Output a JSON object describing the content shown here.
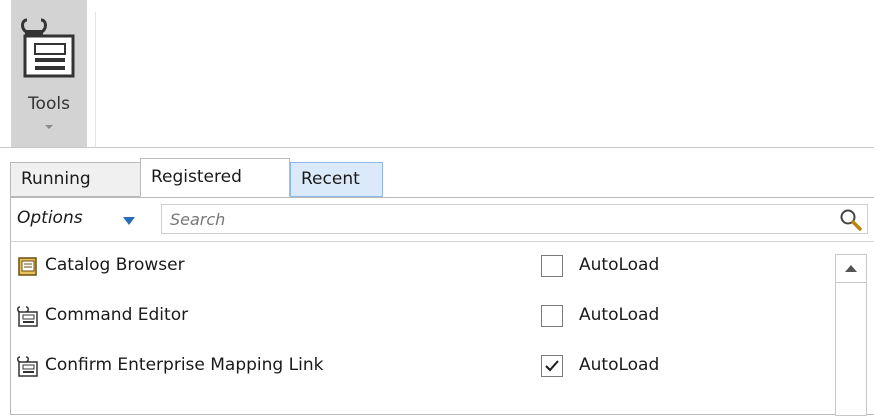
{
  "ribbon": {
    "tools_label": "Tools"
  },
  "tabs": [
    {
      "label": "Running"
    },
    {
      "label": "Registered"
    },
    {
      "label": "Recent"
    }
  ],
  "toolbar": {
    "options_label": "Options",
    "search_placeholder": "Search"
  },
  "rows": [
    {
      "label": "Catalog Browser",
      "icon": "catalog-browser-icon",
      "autoload_label": "AutoLoad",
      "autoload_checked": false
    },
    {
      "label": "Command Editor",
      "icon": "tool-window-icon",
      "autoload_label": "AutoLoad",
      "autoload_checked": false
    },
    {
      "label": "Confirm Enterprise Mapping Link",
      "icon": "tool-window-icon",
      "autoload_label": "AutoLoad",
      "autoload_checked": true
    }
  ],
  "colors": {
    "tools_button_bg": "#d3d3d3",
    "recent_tab_bg": "#dbeafa",
    "options_caret": "#2a6ebb"
  }
}
